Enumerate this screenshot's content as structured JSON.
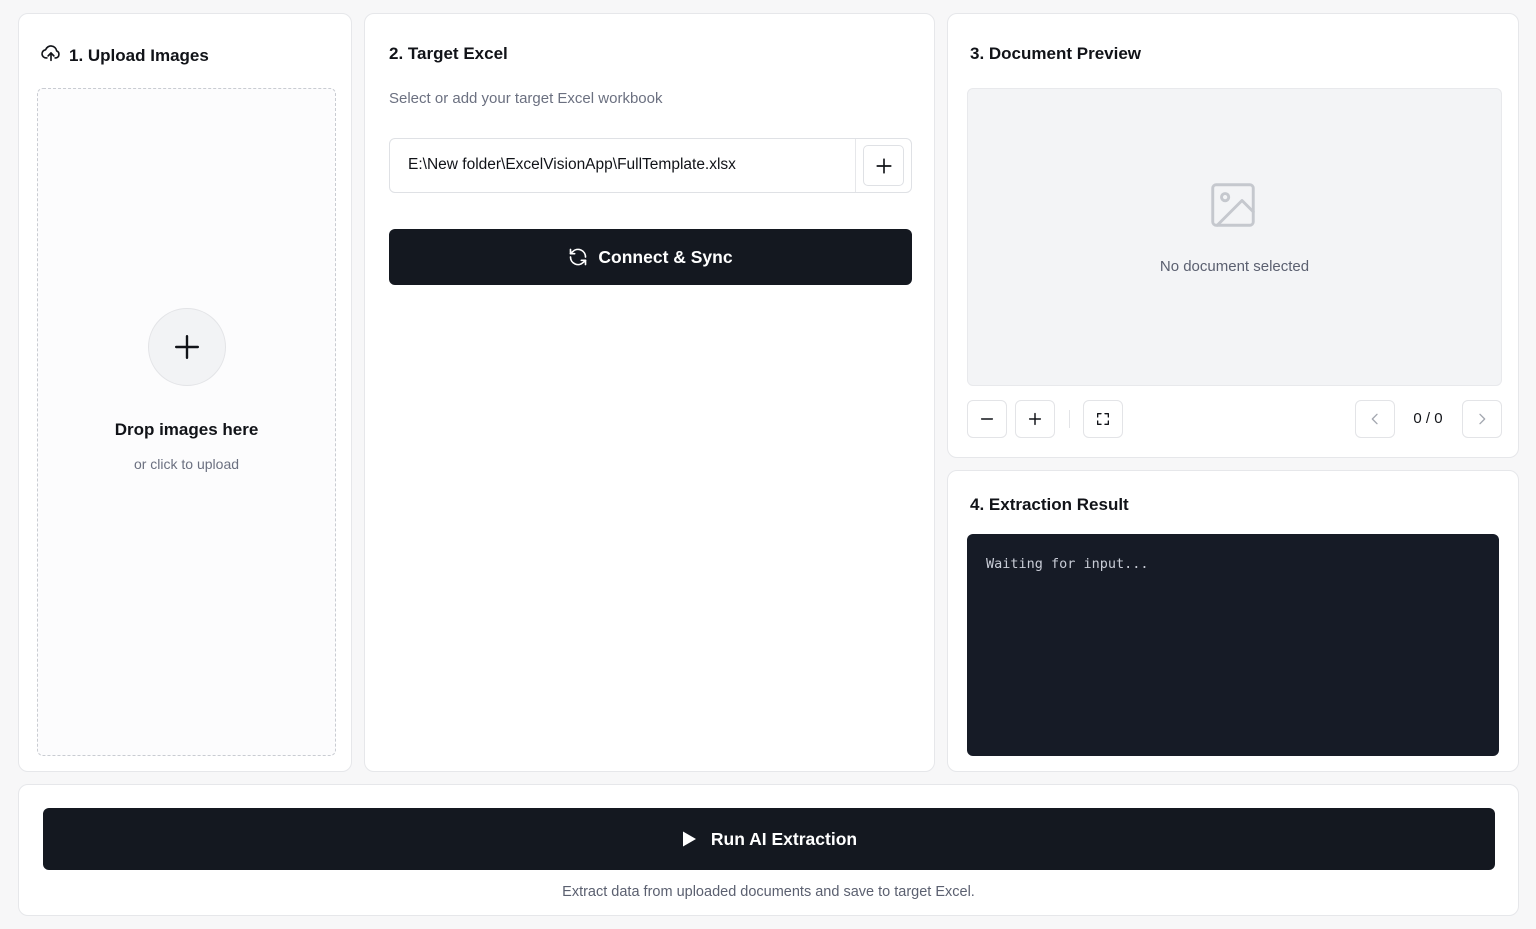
{
  "upload": {
    "title": "1. Upload Images",
    "drop_title": "Drop images here",
    "drop_sub": "or click to upload"
  },
  "excel": {
    "title": "2. Target Excel",
    "subtitle": "Select or add your target Excel workbook",
    "path_value": "E:\\New folder\\ExcelVisionApp\\FullTemplate.xlsx",
    "connect_label": "Connect & Sync"
  },
  "preview": {
    "title": "3. Document Preview",
    "empty_text": "No document selected",
    "page_counter": "0 / 0"
  },
  "result": {
    "title": "4. Extraction Result",
    "console_text": "Waiting for input..."
  },
  "run": {
    "label": "Run AI Extraction",
    "caption": "Extract data from uploaded documents and save to target Excel."
  },
  "colors": {
    "primary_button": "#141820",
    "console_bg": "#161b26",
    "page_bg": "#f7f7f8"
  }
}
